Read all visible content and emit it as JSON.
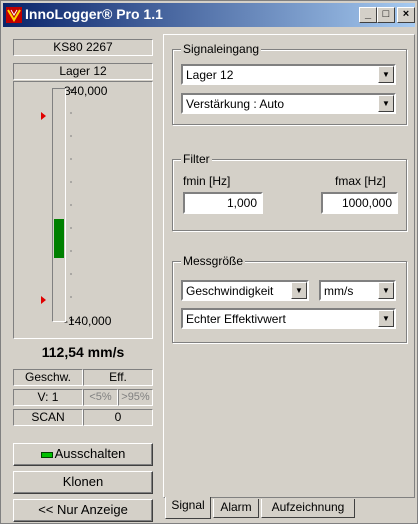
{
  "window": {
    "title": "InnoLogger® Pro 1.1",
    "buttons": {
      "minimize": "_",
      "maximize": "□",
      "close": "×"
    }
  },
  "left": {
    "device_id": "KS80 2267",
    "channel_name": "Lager 12",
    "scale_max": "340,000",
    "scale_min": "-140,000",
    "reading": "112,54 mm/s",
    "mode_label": "Geschw.",
    "mode_type": "Eff.",
    "gain": "V: 1",
    "range_low": "<5%",
    "range_high": ">95%",
    "scan_label": "SCAN",
    "scan_value": "0",
    "bar_level": {
      "low": 0.27,
      "high": 0.44
    },
    "btn_off": "Ausschalten",
    "btn_clone": "Klonen",
    "btn_display": "<< Nur Anzeige",
    "led_color": "#00c000",
    "bar_color": "#008000"
  },
  "signal": {
    "group_title": "Signaleingang",
    "input_select": "Lager 12",
    "gain_select": "Verstärkung : Auto"
  },
  "filter": {
    "group_title": "Filter",
    "fmin_label": "fmin [Hz]",
    "fmax_label": "fmax [Hz]",
    "fmin_value": "1,000",
    "fmax_value": "1000,000"
  },
  "measure": {
    "group_title": "Messgröße",
    "quantity_select": "Geschwindigkeit",
    "unit_select": "mm/s",
    "method_select": "Echter Effektivwert"
  },
  "tabs": [
    "Signal",
    "Alarm",
    "Aufzeichnung"
  ]
}
